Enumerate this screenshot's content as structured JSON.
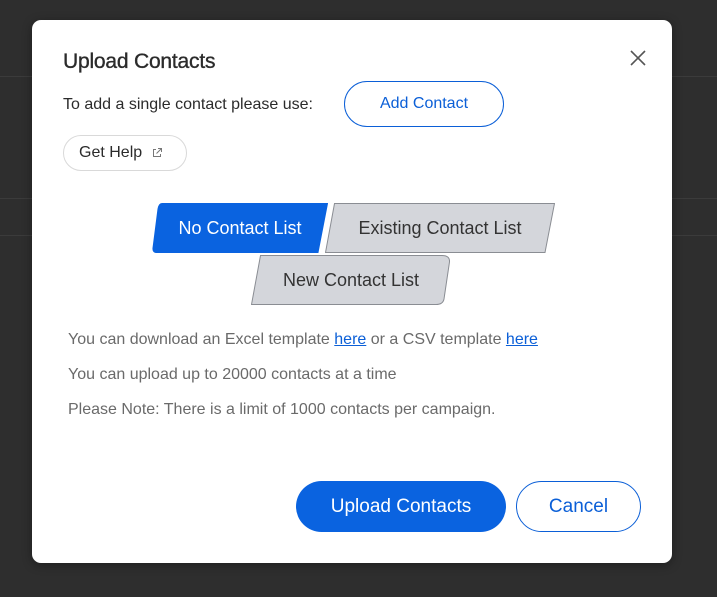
{
  "modal": {
    "title": "Upload Contacts",
    "single_contact_prompt": "To add a single contact please use:",
    "add_contact_label": "Add Contact",
    "get_help_label": "Get Help",
    "list_options": [
      {
        "label": "No Contact List",
        "selected": true
      },
      {
        "label": "Existing Contact List",
        "selected": false
      },
      {
        "label": "New Contact List",
        "selected": false
      }
    ],
    "download_line": {
      "prefix": "You can download an Excel template ",
      "excel_link": "here",
      "middle": " or a CSV template ",
      "csv_link": "here"
    },
    "upload_limit_text": "You can upload up to 20000 contacts at a time",
    "campaign_note_text": "Please Note: There is a limit of 1000 contacts per campaign.",
    "upload_button_label": "Upload Contacts",
    "cancel_button_label": "Cancel"
  },
  "colors": {
    "accent": "#0a63e0",
    "selected_segment": "#0a63e0",
    "unselected_segment": "#d4d6db",
    "overlay": "#2e2e2e"
  },
  "icons": {
    "close": "close-icon",
    "external_link": "external-link-icon"
  }
}
